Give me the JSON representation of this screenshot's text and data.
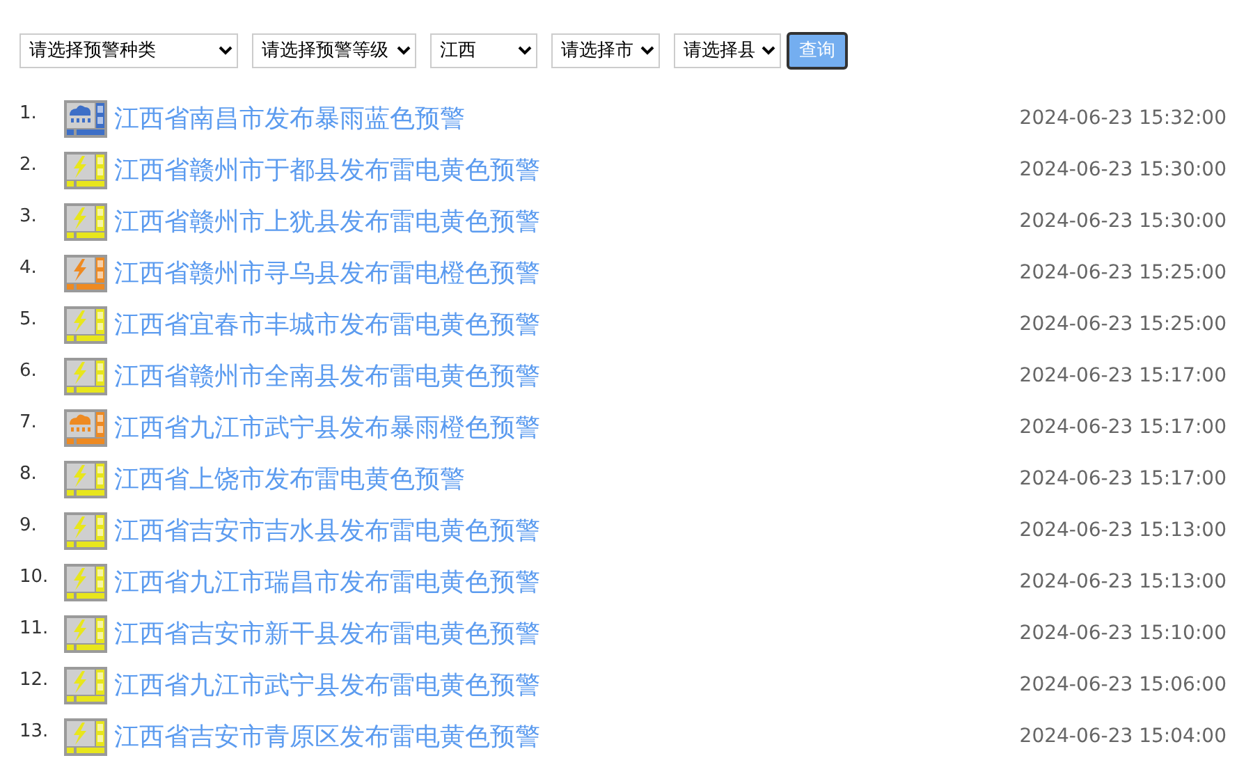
{
  "filters": [
    {
      "value": "请选择预警种类"
    },
    {
      "value": "请选择预警等级"
    },
    {
      "value": "江西"
    },
    {
      "value": "请选择市"
    },
    {
      "value": "请选择县"
    }
  ],
  "query_button": "查询",
  "alerts": [
    {
      "index": "1.",
      "kind": "rain",
      "color": "#3d6fc7",
      "title": "江西省南昌市发布暴雨蓝色预警",
      "time": "2024-06-23 15:32:00"
    },
    {
      "index": "2.",
      "kind": "thunder",
      "color": "#e8e61c",
      "title": "江西省赣州市于都县发布雷电黄色预警",
      "time": "2024-06-23 15:30:00"
    },
    {
      "index": "3.",
      "kind": "thunder",
      "color": "#e8e61c",
      "title": "江西省赣州市上犹县发布雷电黄色预警",
      "time": "2024-06-23 15:30:00"
    },
    {
      "index": "4.",
      "kind": "thunder",
      "color": "#ee8a22",
      "title": "江西省赣州市寻乌县发布雷电橙色预警",
      "time": "2024-06-23 15:25:00"
    },
    {
      "index": "5.",
      "kind": "thunder",
      "color": "#e8e61c",
      "title": "江西省宜春市丰城市发布雷电黄色预警",
      "time": "2024-06-23 15:25:00"
    },
    {
      "index": "6.",
      "kind": "thunder",
      "color": "#e8e61c",
      "title": "江西省赣州市全南县发布雷电黄色预警",
      "time": "2024-06-23 15:17:00"
    },
    {
      "index": "7.",
      "kind": "rain",
      "color": "#ee8a22",
      "title": "江西省九江市武宁县发布暴雨橙色预警",
      "time": "2024-06-23 15:17:00"
    },
    {
      "index": "8.",
      "kind": "thunder",
      "color": "#e8e61c",
      "title": "江西省上饶市发布雷电黄色预警",
      "time": "2024-06-23 15:17:00"
    },
    {
      "index": "9.",
      "kind": "thunder",
      "color": "#e8e61c",
      "title": "江西省吉安市吉水县发布雷电黄色预警",
      "time": "2024-06-23 15:13:00"
    },
    {
      "index": "10.",
      "kind": "thunder",
      "color": "#e8e61c",
      "title": "江西省九江市瑞昌市发布雷电黄色预警",
      "time": "2024-06-23 15:13:00"
    },
    {
      "index": "11.",
      "kind": "thunder",
      "color": "#e8e61c",
      "title": "江西省吉安市新干县发布雷电黄色预警",
      "time": "2024-06-23 15:10:00"
    },
    {
      "index": "12.",
      "kind": "thunder",
      "color": "#e8e61c",
      "title": "江西省九江市武宁县发布雷电黄色预警",
      "time": "2024-06-23 15:06:00"
    },
    {
      "index": "13.",
      "kind": "thunder",
      "color": "#e8e61c",
      "title": "江西省吉安市青原区发布雷电黄色预警",
      "time": "2024-06-23 15:04:00"
    }
  ]
}
